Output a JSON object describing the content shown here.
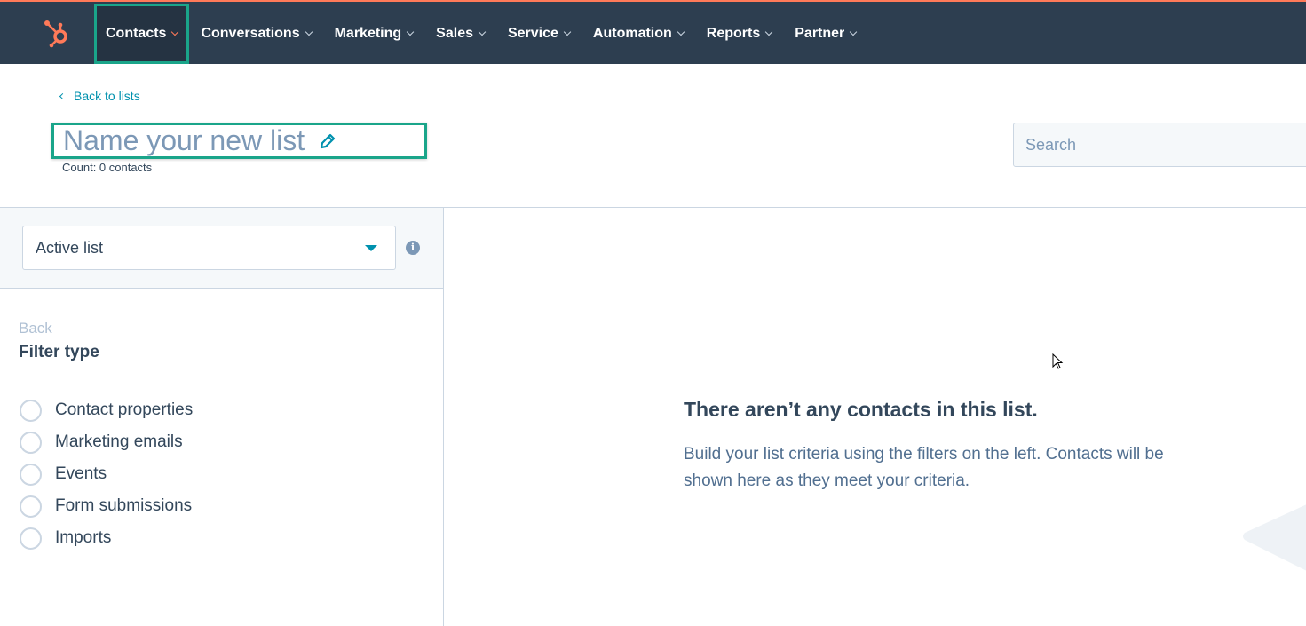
{
  "nav": {
    "logo": "hubspot-sprocket-icon",
    "items": [
      {
        "label": "Contacts",
        "active": true
      },
      {
        "label": "Conversations",
        "active": false
      },
      {
        "label": "Marketing",
        "active": false
      },
      {
        "label": "Sales",
        "active": false
      },
      {
        "label": "Service",
        "active": false
      },
      {
        "label": "Automation",
        "active": false
      },
      {
        "label": "Reports",
        "active": false
      },
      {
        "label": "Partner",
        "active": false
      }
    ]
  },
  "header": {
    "back_link": "Back to lists",
    "title_placeholder": "Name your new list",
    "edit_icon": "pencil-icon",
    "count": "Count: 0 contacts",
    "search_placeholder": "Search"
  },
  "sidebar": {
    "list_type": "Active list",
    "back": "Back",
    "filter_title": "Filter type",
    "filters": [
      "Contact properties",
      "Marketing emails",
      "Events",
      "Form submissions",
      "Imports"
    ]
  },
  "main": {
    "empty_title": "There aren’t any contacts in this list.",
    "empty_description": "Build your list criteria using the filters on the left. Contacts will be shown here as they meet your criteria."
  },
  "colors": {
    "nav_bg": "#2d3e50",
    "accent_orange": "#ff7a59",
    "highlight_green": "#1aa58a",
    "link_teal": "#0091ae"
  }
}
